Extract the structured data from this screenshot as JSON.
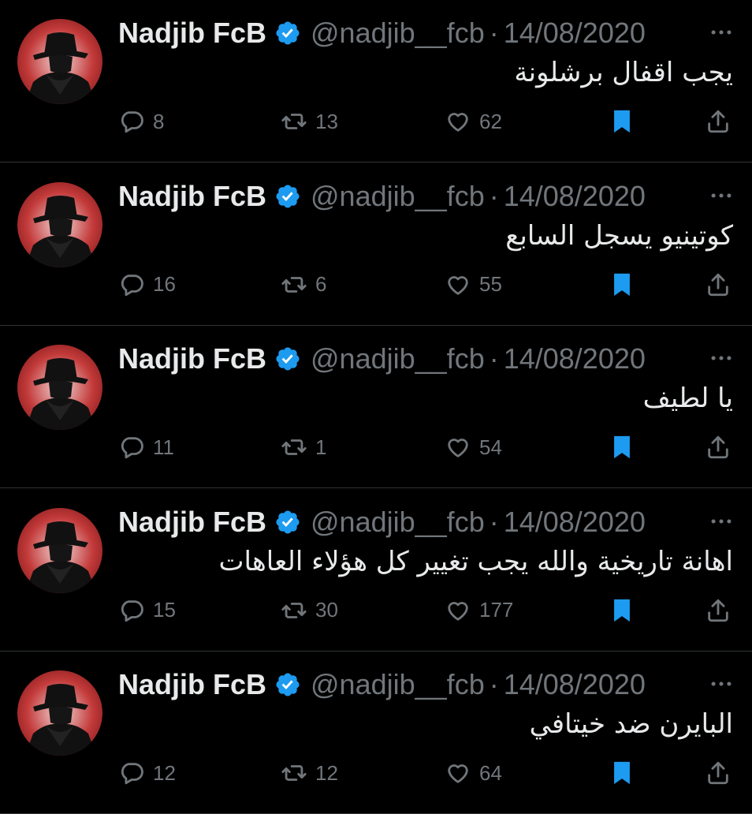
{
  "colors": {
    "background": "#000000",
    "text": "#e7e9ea",
    "muted": "#71767b",
    "verified": "#1d9bf0",
    "bookmark": "#1d9bf0",
    "divider": "#2f3336"
  },
  "icons": {
    "reply": "speech-bubble-icon",
    "retweet": "retweet-icon",
    "like": "heart-icon",
    "bookmark": "bookmark-filled-icon",
    "share": "share-icon",
    "more": "more-dots-icon",
    "verified": "verified-badge-icon"
  },
  "tweets": [
    {
      "name": "Nadjib FcB",
      "handle": "@nadjib__fcb",
      "separator": "·",
      "date": "14/08/2020",
      "text": "يجب اقفال برشلونة",
      "replies": "8",
      "retweets": "13",
      "likes": "62"
    },
    {
      "name": "Nadjib FcB",
      "handle": "@nadjib__fcb",
      "separator": "·",
      "date": "14/08/2020",
      "text": "كوتينيو يسجل السابع",
      "replies": "16",
      "retweets": "6",
      "likes": "55"
    },
    {
      "name": "Nadjib FcB",
      "handle": "@nadjib__fcb",
      "separator": "·",
      "date": "14/08/2020",
      "text": "يا لطيف",
      "replies": "11",
      "retweets": "1",
      "likes": "54"
    },
    {
      "name": "Nadjib FcB",
      "handle": "@nadjib__fcb",
      "separator": "·",
      "date": "14/08/2020",
      "text": "اهانة تاريخية والله يجب تغيير كل هؤلاء العاهات",
      "replies": "15",
      "retweets": "30",
      "likes": "177"
    },
    {
      "name": "Nadjib FcB",
      "handle": "@nadjib__fcb",
      "separator": "·",
      "date": "14/08/2020",
      "text": "البايرن ضد خيتافي",
      "replies": "12",
      "retweets": "12",
      "likes": "64"
    }
  ]
}
